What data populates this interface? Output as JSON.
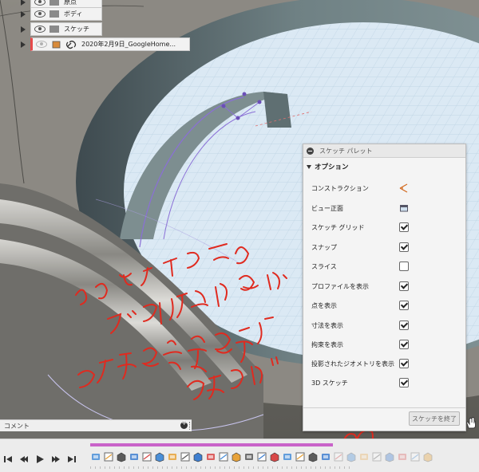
{
  "browser_tree": {
    "items": [
      {
        "label": "原点",
        "type": "folder"
      },
      {
        "label": "ボディ",
        "type": "folder"
      },
      {
        "label": "スケッチ",
        "type": "folder"
      },
      {
        "label": "2020年2月9日_GoogleHome...",
        "type": "link"
      }
    ]
  },
  "sketch_palette": {
    "title": "スケッチ パレット",
    "section_label": "オプション",
    "rows": [
      {
        "label": "コンストラクション",
        "control": "construction-icon",
        "checked": null
      },
      {
        "label": "ビュー正面",
        "control": "look-at-icon",
        "checked": null
      },
      {
        "label": "スケッチ グリッド",
        "control": "checkbox",
        "checked": true
      },
      {
        "label": "スナップ",
        "control": "checkbox",
        "checked": true
      },
      {
        "label": "スライス",
        "control": "checkbox",
        "checked": false
      },
      {
        "label": "プロファイルを表示",
        "control": "checkbox",
        "checked": true
      },
      {
        "label": "点を表示",
        "control": "checkbox",
        "checked": true
      },
      {
        "label": "寸法を表示",
        "control": "checkbox",
        "checked": true
      },
      {
        "label": "拘束を表示",
        "control": "checkbox",
        "checked": true
      },
      {
        "label": "投影されたジオメトリを表示",
        "control": "checkbox",
        "checked": true
      },
      {
        "label": "3D スケッチ",
        "control": "checkbox",
        "checked": true
      }
    ],
    "finish_button": "スケッチを終了"
  },
  "comment_bar": {
    "label": "コメント"
  },
  "timeline": {
    "controls": [
      "skip-to-start-icon",
      "step-back-icon",
      "play-icon",
      "step-forward-icon",
      "skip-to-end-icon"
    ],
    "feature_count": 27,
    "active_features": 19
  },
  "handwritten_note": "さらにアイコンを ダブルクリックすると スケッチの編集まで 戻れるよ",
  "colors": {
    "accent": "#c963c9",
    "annotation_red": "#e02a1f",
    "sketch_plane": "#dbe9f4",
    "rim_dark": "#6b6a66"
  }
}
